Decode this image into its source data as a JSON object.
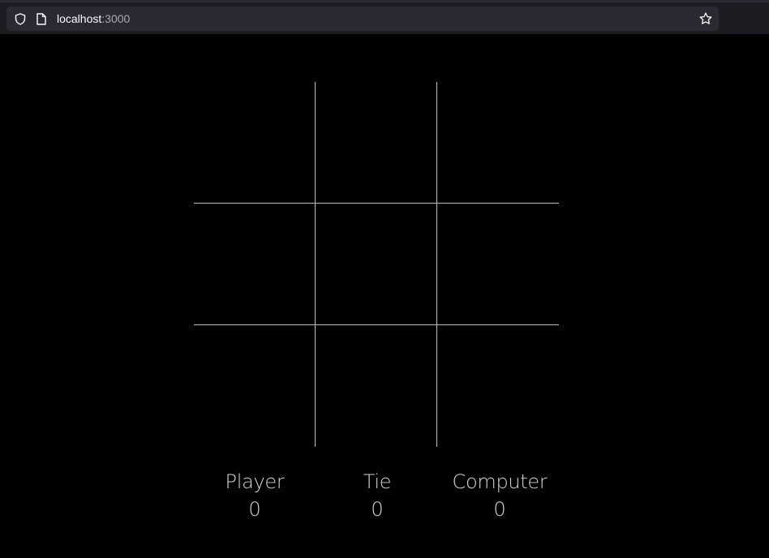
{
  "browser": {
    "url_host": "localhost",
    "url_port": ":3000",
    "icons": {
      "site_info": "shield-icon",
      "page": "page-icon",
      "bookmark": "star-icon"
    }
  },
  "board": {
    "cells": [
      "",
      "",
      "",
      "",
      "",
      "",
      "",
      "",
      ""
    ],
    "line_color": "#bdbdbd",
    "background": "#000000"
  },
  "scores": {
    "player": {
      "label": "Player",
      "value": "0"
    },
    "tie": {
      "label": "Tie",
      "value": "0"
    },
    "computer": {
      "label": "Computer",
      "value": "0"
    }
  }
}
